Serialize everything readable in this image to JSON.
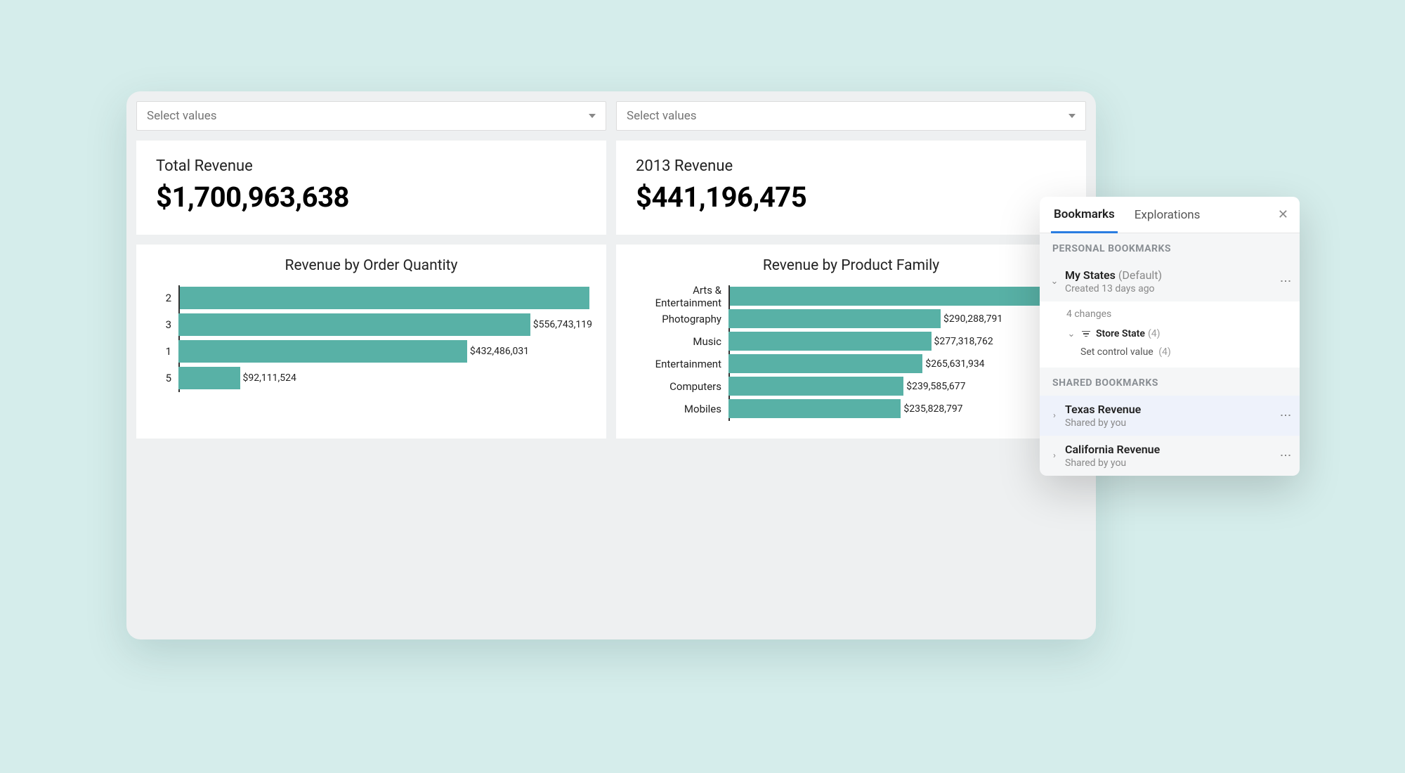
{
  "filters": {
    "left_placeholder": "Select values",
    "right_placeholder": "Select values"
  },
  "kpis": {
    "total": {
      "title": "Total Revenue",
      "value": "$1,700,963,638"
    },
    "year": {
      "title": "2013 Revenue",
      "value": "$441,196,475"
    }
  },
  "chart_data": [
    {
      "type": "bar",
      "orientation": "horizontal",
      "title": "Revenue by Order Quantity",
      "xlabel": "",
      "ylabel": "",
      "categories": [
        "2",
        "3",
        "1",
        "5"
      ],
      "values": [
        619623000,
        556743119,
        432486031,
        92111524
      ],
      "value_labels": [
        "",
        "$556,743,119",
        "$432,486,031",
        "$92,111,524"
      ],
      "xlim": [
        0,
        620000000
      ]
    },
    {
      "type": "bar",
      "orientation": "horizontal",
      "title": "Revenue by Product Family",
      "xlabel": "",
      "ylabel": "",
      "categories": [
        "Arts & Entertainment",
        "Photography",
        "Music",
        "Entertainment",
        "Computers",
        "Mobiles"
      ],
      "values": [
        470000000,
        290288791,
        277318762,
        265631934,
        239585677,
        235828797
      ],
      "value_labels": [
        "",
        "$290,288,791",
        "$277,318,762",
        "$265,631,934",
        "$239,585,677",
        "$235,828,797"
      ],
      "xlim": [
        0,
        470000000
      ]
    }
  ],
  "bookmarks_panel": {
    "tabs": {
      "bookmarks": "Bookmarks",
      "explorations": "Explorations"
    },
    "sections": {
      "personal": {
        "header": "PERSONAL BOOKMARKS",
        "items": [
          {
            "title": "My States",
            "suffix": "(Default)",
            "sub": "Created 13 days ago"
          }
        ],
        "changes": {
          "summary": "4 changes",
          "store_state_label": "Store State",
          "store_state_count": "(4)",
          "set_control_label": "Set control value",
          "set_control_count": "(4)"
        }
      },
      "shared": {
        "header": "SHARED BOOKMARKS",
        "items": [
          {
            "title": "Texas Revenue",
            "sub": "Shared by you"
          },
          {
            "title": "California Revenue",
            "sub": "Shared by you"
          }
        ]
      }
    }
  },
  "colors": {
    "bar": "#58b1a6",
    "accent": "#2a7de1"
  }
}
